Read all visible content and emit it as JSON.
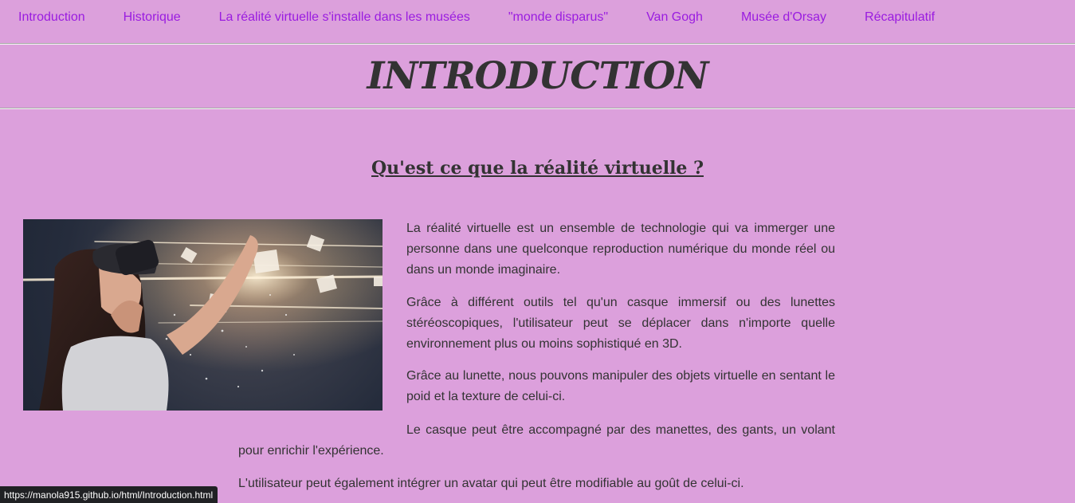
{
  "nav": {
    "items": [
      "Introduction",
      "Historique",
      "La réalité virtuelle s'installe dans les musées",
      "\"monde disparus\"",
      "Van Gogh",
      "Musée d'Orsay",
      "Récapitulatif"
    ],
    "link_color": "#9a1ce0"
  },
  "page": {
    "title": "INTRODUCTION",
    "subtitle": "Qu'est ce que la réalité virtuelle ?",
    "background": "#dca0dc"
  },
  "content": {
    "paragraphs": [
      "La réalité virtuelle est un ensemble de technologie qui va immerger une personne dans une quelconque reproduction numérique du monde réel ou dans un monde imaginaire.",
      "Grâce à différent outils tel qu'un casque immersif ou des lunettes stéréoscopiques, l'utilisateur peut se déplacer dans n'importe quelle environnement plus ou moins sophistiqué en 3D.",
      "Grâce au lunette, nous pouvons manipuler des objets virtuelle en sentant le poid et la texture de celui-ci.",
      "Le casque peut être accompagné par des manettes, des gants, un volant pour enrichir l'expérience.",
      "L'utilisateur peut également intégrer un avatar qui peut être modifiable au goût de celui-ci."
    ]
  },
  "status_bar": {
    "url": "https://manola915.github.io/html/Introduction.html"
  }
}
